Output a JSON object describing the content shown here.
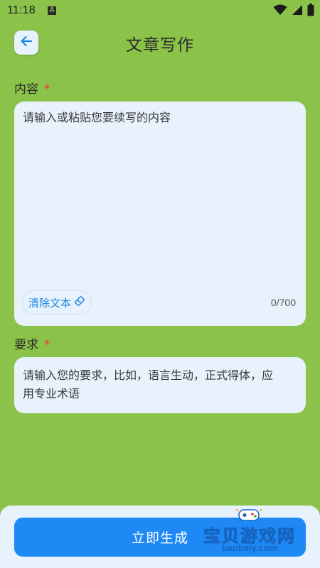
{
  "status_bar": {
    "time": "11:18",
    "notification_icon": "a-icon",
    "icons": [
      "wifi-icon",
      "signal-icon",
      "battery-icon"
    ]
  },
  "header": {
    "title": "文章写作",
    "back_icon": "arrow-left-icon"
  },
  "content": {
    "label": "内容",
    "required_mark": "*",
    "placeholder": "请输入或粘贴您要续写的内容",
    "clear_label": "清除文本",
    "clear_icon": "eraser-icon",
    "counter": "0/700"
  },
  "requirement": {
    "label": "要求",
    "required_mark": "*",
    "placeholder": "请输入您的要求，比如，语言生动，正式得体，应用专业术语"
  },
  "actions": {
    "generate_label": "立即生成"
  },
  "watermark": {
    "title": "宝贝游戏网",
    "domain": "baobeiy.com"
  },
  "colors": {
    "background": "#8bc34a",
    "card": "#e8f2fc",
    "accent": "#1e88f5",
    "required": "#e53935"
  }
}
